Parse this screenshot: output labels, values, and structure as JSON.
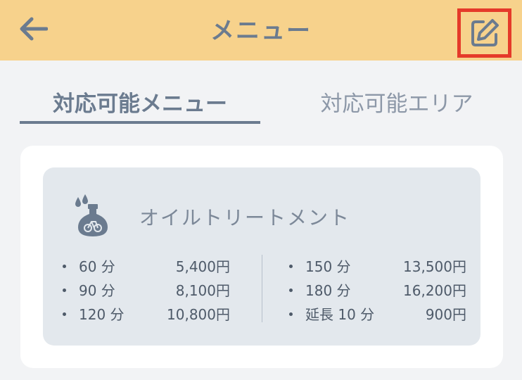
{
  "header": {
    "title": "メニュー",
    "back_icon": "arrow-left-icon",
    "edit_icon": "pencil-square-icon",
    "accent_color": "#f7d28c",
    "highlight_color": "#e53a2a"
  },
  "tabs": [
    {
      "label": "対応可能メニュー",
      "active": true
    },
    {
      "label": "対応可能エリア",
      "active": false
    }
  ],
  "service": {
    "icon": "oil-bottle-icon",
    "name": "オイルトリートメント",
    "prices_left": [
      {
        "duration": "60 分",
        "price": "5,400円"
      },
      {
        "duration": "90 分",
        "price": "8,100円"
      },
      {
        "duration": "120 分",
        "price": "10,800円"
      }
    ],
    "prices_right": [
      {
        "duration": "150 分",
        "price": "13,500円"
      },
      {
        "duration": "180 分",
        "price": "16,200円"
      },
      {
        "duration": "延長 10 分",
        "price": "900円"
      }
    ]
  }
}
